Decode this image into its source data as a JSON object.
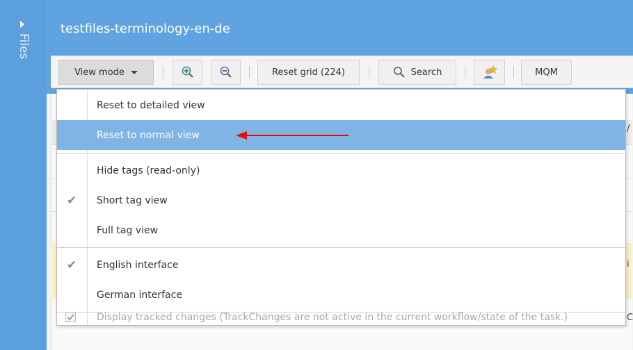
{
  "sidebar": {
    "label": "Files",
    "toggle_icon": "caret-right-icon"
  },
  "header": {
    "title": "testfiles-terminology-en-de"
  },
  "toolbar": {
    "view_mode_label": "View mode",
    "zoom_in_icon": "zoom-in-icon",
    "zoom_out_icon": "zoom-out-icon",
    "reset_grid_label": "Reset grid (224)",
    "search_label": "Search",
    "user_icon": "user-star-icon",
    "mqm_label": "MQM"
  },
  "menu": {
    "items": [
      {
        "label": "Reset to detailed view",
        "checked": false,
        "selected": false
      },
      {
        "label": "Reset to normal view",
        "checked": false,
        "selected": true
      },
      {
        "label": "Hide tags (read-only)",
        "checked": false,
        "selected": false
      },
      {
        "label": "Short tag view",
        "checked": true,
        "selected": false
      },
      {
        "label": "Full tag view",
        "checked": false,
        "selected": false
      },
      {
        "label": "English interface",
        "checked": true,
        "selected": false
      },
      {
        "label": "German interface",
        "checked": false,
        "selected": false
      },
      {
        "label": "Display tracked changes (TrackChanges are not active in the current workflow/state of the task.)",
        "checked": true,
        "selected": false,
        "disabled": true
      }
    ]
  },
  "background_fragments": {
    "frag1": "/",
    "frag2": "i",
    "frag3": "C"
  },
  "colors": {
    "header": "#5fa3e0",
    "sidebar": "#5b9fdc",
    "selected_item": "#7fb4e5",
    "annotation_arrow": "#e01010"
  }
}
